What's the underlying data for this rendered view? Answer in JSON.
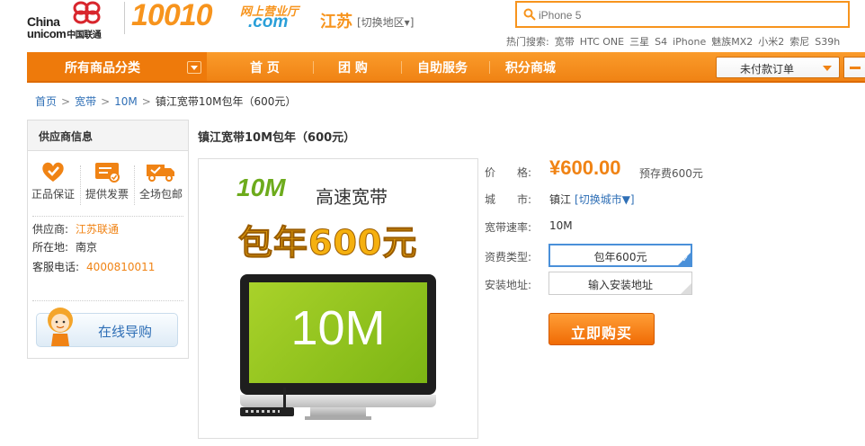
{
  "header": {
    "logo_china": "China",
    "logo_unicom": "unicom",
    "logo_unicom_cn": "中国联通",
    "logo_number": "10010",
    "logo_hall": "网上营业厅",
    "logo_domain": ".com",
    "region": "江苏",
    "region_switch": "[切换地区▾]",
    "search_placeholder": "iPhone 5",
    "hot_search": {
      "label": "热门搜索:",
      "items": [
        "宽带",
        "HTC ONE",
        "三星",
        "S4",
        "iPhone",
        "魅族MX2",
        "小米2",
        "索尼",
        "S39h"
      ]
    }
  },
  "nav": {
    "category_label": "所有商品分类",
    "items": [
      "首 页",
      "团 购",
      "自助服务",
      "积分商城"
    ],
    "order_dropdown": "未付款订单"
  },
  "breadcrumb": [
    "首页",
    "宽带",
    "10M",
    "镇江宽带10M包年（600元）"
  ],
  "supplier": {
    "title": "供应商信息",
    "badges": [
      "正品保证",
      "提供发票",
      "全场包邮"
    ],
    "rows": [
      {
        "label": "供应商:",
        "value": "江苏联通"
      },
      {
        "label": "所在地:",
        "value": "南京"
      },
      {
        "label": "客服电话:",
        "value": "4000810011"
      }
    ],
    "guide_button": "在线导购"
  },
  "product": {
    "title": "镇江宽带10M包年（600元）",
    "image": {
      "speed_big": "10M",
      "speed_text": "高速宽带",
      "year_text": "包年600元",
      "screen_text": "10M"
    },
    "price_label": "价　　格:",
    "price": "¥600.00",
    "deposit": "预存费600元",
    "city_label": "城　　市:",
    "city": "镇江",
    "city_switch": "[切换城市▼]",
    "speed_label": "宽带速率:",
    "speed": "10M",
    "fee_label": "资费类型:",
    "fee_option": "包年600元",
    "address_label": "安装地址:",
    "address_option": "输入安装地址",
    "buy_button": "立即购买"
  },
  "colors": {
    "brand_orange": "#f7941d",
    "nav_orange": "#f08314",
    "link_blue": "#2f6fb6",
    "select_blue": "#4a90d9"
  }
}
